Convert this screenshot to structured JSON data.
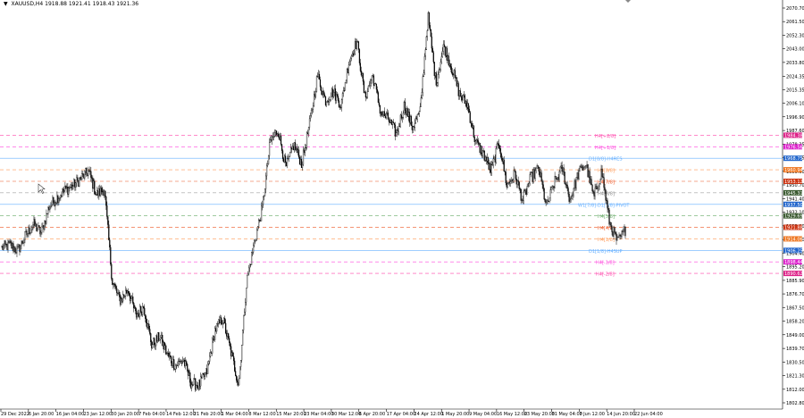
{
  "header": {
    "symbol_label": "XAUUSD,H4",
    "ohlc_text": "1918.88 1921.41 1918.43 1921.36"
  },
  "chart_data": {
    "type": "candlestick",
    "symbol": "XAUUSD",
    "timeframe": "H4",
    "ylim": [
      1801.0,
      2074.0
    ],
    "y_ticks": [
      "2070.70",
      "2061.50",
      "2052.30",
      "2043.00",
      "2033.80",
      "2024.35",
      "2015.35",
      "2006.10",
      "1996.90",
      "1987.60",
      "1978.35",
      "1969.15",
      "1959.90",
      "1950.70",
      "1941.40",
      "1932.10",
      "1922.90",
      "1913.60",
      "1904.40",
      "1895.20",
      "1885.90",
      "1876.70",
      "1867.50",
      "1858.20",
      "1849.00",
      "1839.70",
      "1830.50",
      "1821.30",
      "1812.00",
      "1802.80"
    ],
    "x_ticks": [
      "29 Dec 2022",
      "6 Jan 20:00",
      "16 Jan 04:00",
      "23 Jan 12:00",
      "30 Jan 20:00",
      "7 Feb 04:00",
      "14 Feb 12:00",
      "21 Feb 20:00",
      "1 Mar 04:00",
      "8 Mar 12:00",
      "15 Mar 20:00",
      "23 Mar 04:00",
      "30 Mar 12:00",
      "6 Apr 20:00",
      "17 Apr 04:00",
      "24 Apr 12:00",
      "1 May 20:00",
      "9 May 04:00",
      "16 May 12:00",
      "23 May 20:00",
      "31 May 04:00",
      "7 Jun 12:00",
      "14 Jun 20:00",
      "22 Jun 04:00"
    ],
    "price_anchors": [
      1908,
      1910,
      1906,
      1916,
      1924,
      1918,
      1936,
      1942,
      1947,
      1950,
      1955,
      1960,
      1944,
      1948,
      1885,
      1872,
      1880,
      1862,
      1868,
      1842,
      1848,
      1835,
      1828,
      1832,
      1816,
      1815,
      1824,
      1852,
      1860,
      1838,
      1815,
      1885,
      1912,
      1935,
      1980,
      1988,
      1962,
      1978,
      1965,
      1992,
      2025,
      2008,
      2014,
      2005,
      2035,
      2048,
      2010,
      2025,
      2000,
      1995,
      1985,
      2005,
      1990,
      2000,
      2065,
      2020,
      2045,
      2030,
      2012,
      2005,
      1980,
      1972,
      1960,
      1980,
      1950,
      1958,
      1940,
      1955,
      1962,
      1936,
      1952,
      1962,
      1940,
      1958,
      1965,
      1942,
      1960,
      1925,
      1912,
      1920
    ],
    "levels": [
      {
        "label": "H4[+2/8]",
        "value": "1984.38",
        "color": "#ff44aa",
        "dash": true,
        "label_x": 666
      },
      {
        "label": "H4[+1/8]",
        "value": "1976.56",
        "color": "#ff44dd",
        "dash": true,
        "label_x": 666
      },
      {
        "label": "D1[8/8]-H4RES",
        "value": "1968.75",
        "color": "#66b0ff",
        "dash": false,
        "label_x": 659
      },
      {
        "label": "H4[8/8]",
        "value": "1960.94",
        "color": "#ff9955",
        "dash": true,
        "label_x": 669
      },
      {
        "label": "H4[7/8]",
        "value": "1953.12",
        "color": "#ee5522",
        "dash": true,
        "label_x": 669
      },
      {
        "label": "H4[6/8]",
        "value": "1945.31",
        "color": "#888888",
        "dash": true,
        "label_x": 669
      },
      {
        "label": "W1[7/8]-D1[7/8]-PIVOT",
        "value": "1937.50",
        "color": "#66b0ff",
        "dash": false,
        "label_x": 647
      },
      {
        "label": "H4[5/8]",
        "value": "1929.69",
        "color": "#66aa66",
        "dash": true,
        "label_x": 669
      },
      {
        "label": "H4[4/8]",
        "value": "1921.88",
        "color": "#ee5522",
        "dash": true,
        "label_x": 669
      },
      {
        "label": "H4[1/8]",
        "value": "1914.06",
        "color": "#ff9955",
        "dash": true,
        "label_x": 669
      },
      {
        "label": "D1[1/8]-H4SUP",
        "value": "1906.25",
        "color": "#66b0ff",
        "dash": false,
        "label_x": 659
      },
      {
        "label": "H4[-1/8]",
        "value": "1898.44",
        "color": "#ff44dd",
        "dash": true,
        "label_x": 667
      },
      {
        "label": "H4[-2/8]",
        "value": "1890.62",
        "color": "#ff44aa",
        "dash": true,
        "label_x": 667
      }
    ],
    "price_tags": [
      {
        "value": "1984.38",
        "color": "#dd2288"
      },
      {
        "value": "1976.56",
        "color": "#dd22cc"
      },
      {
        "value": "1968.75",
        "color": "#2266cc"
      },
      {
        "value": "1960.94",
        "color": "#ee7722"
      },
      {
        "value": "1953.12",
        "color": "#cc3311"
      },
      {
        "value": "1945.31",
        "color": "#3a5a30"
      },
      {
        "value": "1937.50",
        "color": "#2266cc"
      },
      {
        "value": "1929.69",
        "color": "#3a5a30"
      },
      {
        "value": "1921.88",
        "color": "#cc3311"
      },
      {
        "value": "1914.06",
        "color": "#ee7722"
      },
      {
        "value": "1906.25",
        "color": "#2266cc"
      },
      {
        "value": "1898.44",
        "color": "#dd22cc"
      },
      {
        "value": "1890.62",
        "color": "#dd2288"
      }
    ]
  }
}
